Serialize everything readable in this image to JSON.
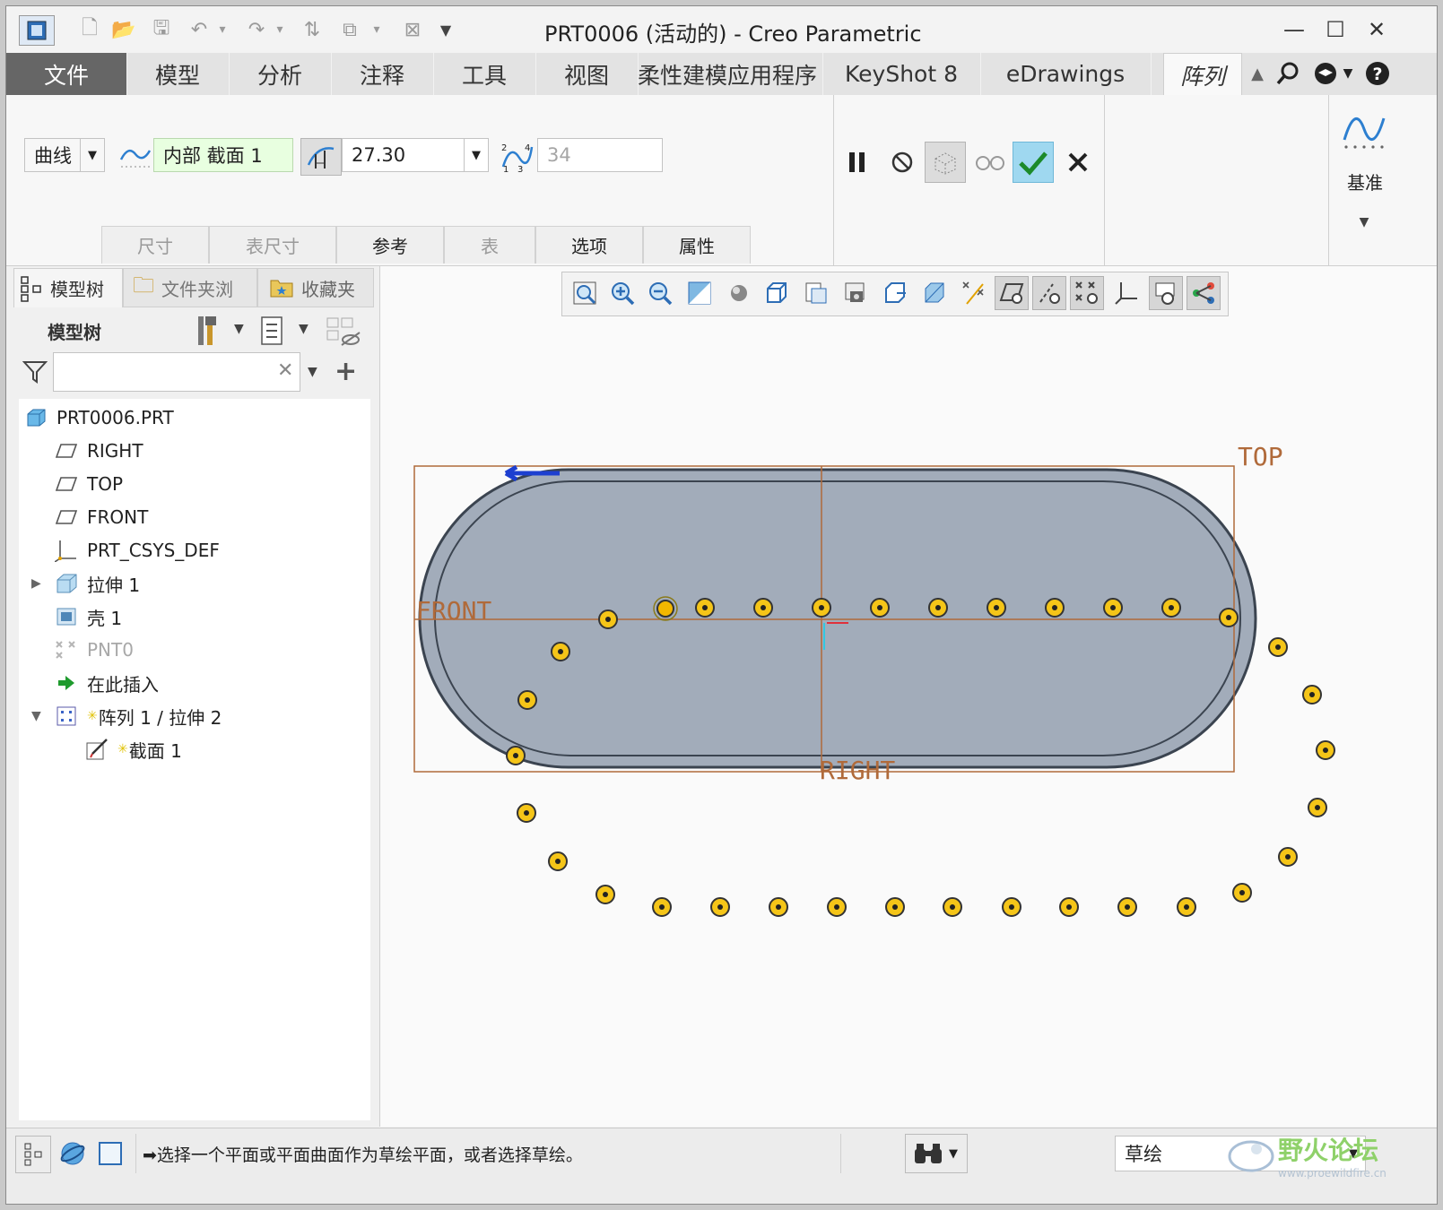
{
  "window": {
    "title": "PRT0006 (活动的) - Creo Parametric",
    "controls": {
      "minimize": "—",
      "maximize": "☐",
      "close": "✕"
    }
  },
  "menu": {
    "items": [
      "文件",
      "模型",
      "分析",
      "注释",
      "工具",
      "视图",
      "柔性建模",
      "应用程序",
      "KeyShot 8",
      "eDrawings",
      "阵列"
    ],
    "active": "阵列"
  },
  "ribbon": {
    "pattern_type": "曲线",
    "reference_field": "内部 截面 1",
    "spacing_value": "27.30",
    "member_count": "34",
    "group_label": "基准",
    "subtabs": [
      {
        "label": "尺寸",
        "enabled": false
      },
      {
        "label": "表尺寸",
        "enabled": false
      },
      {
        "label": "参考",
        "enabled": true
      },
      {
        "label": "表",
        "enabled": false
      },
      {
        "label": "选项",
        "enabled": true
      },
      {
        "label": "属性",
        "enabled": true
      }
    ]
  },
  "panel": {
    "tabs": [
      "模型树",
      "文件夹浏",
      "收藏夹"
    ],
    "header": "模型树",
    "search_value": "",
    "tree": [
      {
        "label": "PRT0006.PRT",
        "icon": "part-icon",
        "level": 0
      },
      {
        "label": "RIGHT",
        "icon": "datum-plane-icon",
        "level": 1
      },
      {
        "label": "TOP",
        "icon": "datum-plane-icon",
        "level": 1
      },
      {
        "label": "FRONT",
        "icon": "datum-plane-icon",
        "level": 1
      },
      {
        "label": "PRT_CSYS_DEF",
        "icon": "csys-icon",
        "level": 1
      },
      {
        "label": "拉伸 1",
        "icon": "extrude-icon",
        "level": 1
      },
      {
        "label": "壳 1",
        "icon": "shell-icon",
        "level": 1
      },
      {
        "label": "PNT0",
        "icon": "datum-point-icon",
        "level": 1
      },
      {
        "label": "在此插入",
        "icon": "insert-arrow-icon",
        "level": 1
      },
      {
        "label": "阵列 1 / 拉伸 2",
        "icon": "pattern-icon",
        "level": 1
      },
      {
        "label": "截面 1",
        "icon": "sketch-icon",
        "level": 2
      }
    ]
  },
  "viewport": {
    "datum_labels": {
      "top": "TOP",
      "front": "FRONT",
      "right": "RIGHT"
    },
    "colors": {
      "plate": "#a2acba",
      "edge": "#3b4450",
      "marker_fill": "#f5c518",
      "datum": "#b06a3a"
    }
  },
  "status": {
    "message": "➡选择一个平面或平面曲面作为草绘平面，或者选择草绘。",
    "filter": "草绘",
    "watermark": "野火论坛",
    "watermark_url": "www.proewildfire.cn"
  }
}
